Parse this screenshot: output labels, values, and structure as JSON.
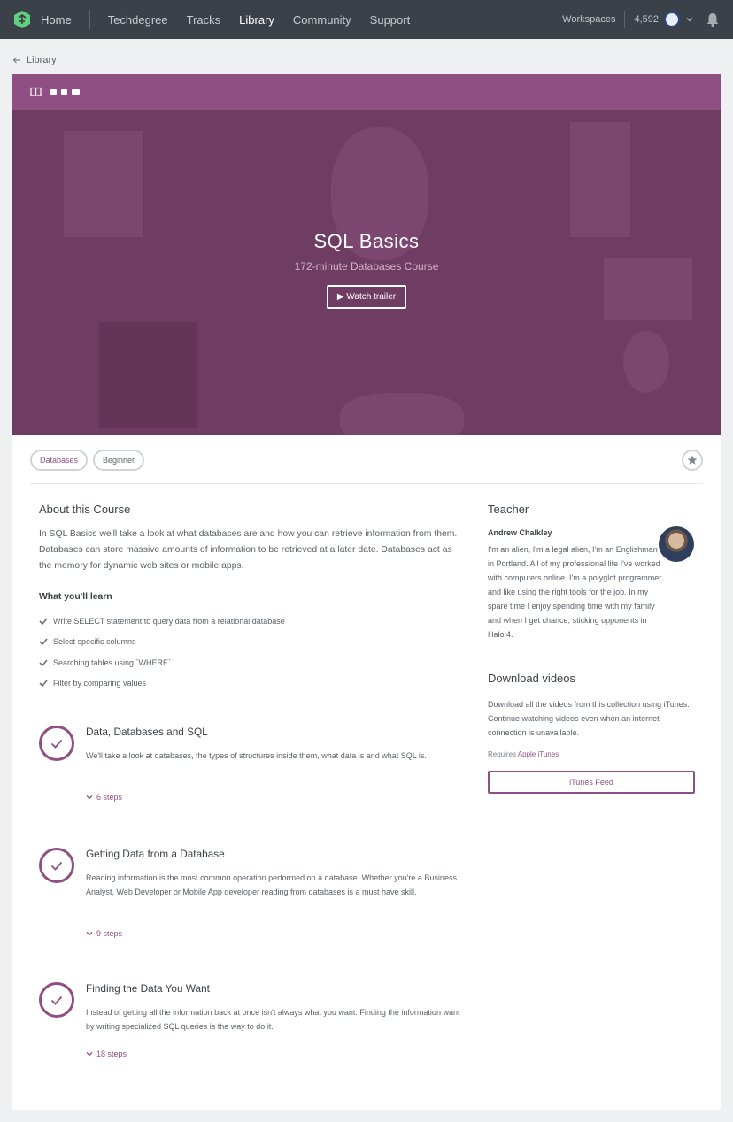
{
  "nav": {
    "home": "Home",
    "links": [
      "Techdegree",
      "Tracks",
      "Library",
      "Community",
      "Support"
    ],
    "active": "Library",
    "workspaces": "Workspaces",
    "points": "4,592"
  },
  "breadcrumb": {
    "label": "Library"
  },
  "hero": {
    "title": "SQL Basics",
    "subtitle": "172-minute Databases Course",
    "trailer": "▶ Watch trailer"
  },
  "tags": [
    "Databases",
    "Beginner"
  ],
  "about": {
    "title": "About this Course",
    "text": "In SQL Basics we'll take a look at what databases are and how you can retrieve information from them. Databases can store massive amounts of information to be retrieved at a later date. Databases act as the memory for dynamic web sites or mobile apps.",
    "learn_title": "What you'll learn",
    "learn": [
      "Write SELECT statement to query data from a relational database",
      "Select specific columns",
      "Searching tables using `WHERE`",
      "Filter by comparing values"
    ]
  },
  "stages": [
    {
      "title": "Data, Databases and SQL",
      "desc": "We'll take a look at databases, the types of structures inside them, what data is and what SQL is.",
      "steps": "6 steps"
    },
    {
      "title": "Getting Data from a Database",
      "desc": "Reading information is the most common operation performed on a database. Whether you're a Business Analyst, Web Developer or Mobile App developer reading from databases is a must have skill.",
      "steps": "9 steps"
    },
    {
      "title": "Finding the Data You Want",
      "desc": "Instead of getting all the information back at once isn't always what you want. Finding the information want by writing specialized SQL queries is the way to do it.",
      "steps": "18 steps"
    }
  ],
  "teacher": {
    "heading": "Teacher",
    "name": "Andrew Chalkley",
    "bio": "I'm an alien, I'm a legal alien, I'm an Englishman in Portland. All of my professional life I've worked with computers online. I'm a polyglot programmer and like using the right tools for the job. In my spare time I enjoy spending time with my family and when I get chance, sticking opponents in Halo 4."
  },
  "download": {
    "title": "Download videos",
    "text": "Download all the videos from this collection using iTunes. Continue watching videos even when an internet connection is unavailable.",
    "requires": "Requires",
    "requires_link": "Apple iTunes",
    "button": "iTunes Feed"
  },
  "colors": {
    "brand": "#904f83",
    "nav": "#3a4149",
    "logo": "#5fcf80"
  }
}
